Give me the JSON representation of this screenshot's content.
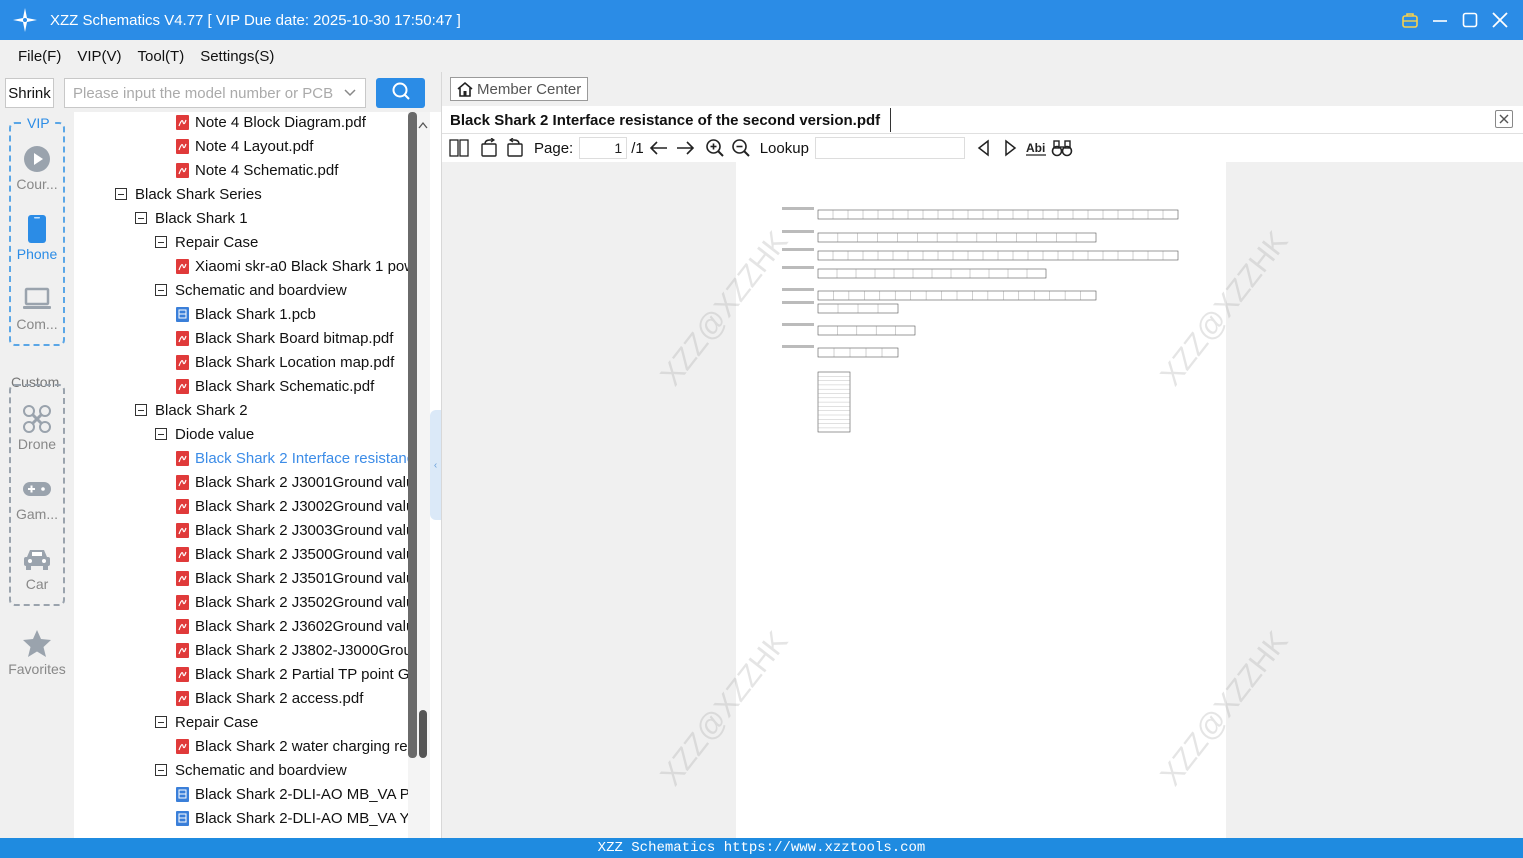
{
  "app": {
    "title": "XZZ Schematics V4.77 [ VIP Due date: 2025-10-30 17:50:47 ]",
    "accent_color": "#2b8ce6"
  },
  "menu": [
    "File(F)",
    "VIP(V)",
    "Tool(T)",
    "Settings(S)"
  ],
  "search": {
    "shrink_label": "Shrink",
    "placeholder": "Please input the model number or PCB"
  },
  "sidebar": {
    "vip_label": "VIP",
    "custom_label": "Custom",
    "items": [
      {
        "label": "Cour...",
        "icon": "play-circle-icon"
      },
      {
        "label": "Phone",
        "icon": "phone-icon"
      },
      {
        "label": "Com...",
        "icon": "laptop-icon"
      },
      {
        "label": "Drone",
        "icon": "drone-icon"
      },
      {
        "label": "Gam...",
        "icon": "gamepad-icon"
      },
      {
        "label": "Car",
        "icon": "car-icon"
      },
      {
        "label": "Favorites",
        "icon": "star-icon"
      }
    ]
  },
  "tree": [
    {
      "label": "Note 4 Block Diagram.pdf",
      "level": 4,
      "type": "pdf"
    },
    {
      "label": "Note 4 Layout.pdf",
      "level": 4,
      "type": "pdf"
    },
    {
      "label": "Note 4 Schematic.pdf",
      "level": 4,
      "type": "pdf"
    },
    {
      "label": "Black Shark Series",
      "level": 1,
      "type": "folder"
    },
    {
      "label": "Black Shark 1",
      "level": 2,
      "type": "folder"
    },
    {
      "label": "Repair Case",
      "level": 3,
      "type": "folder"
    },
    {
      "label": "Xiaomi skr-a0 Black Shark 1 pow",
      "level": 4,
      "type": "pdf"
    },
    {
      "label": "Schematic and boardview",
      "level": 3,
      "type": "folder"
    },
    {
      "label": "Black Shark 1.pcb",
      "level": 4,
      "type": "pcb"
    },
    {
      "label": "Black Shark Board bitmap.pdf",
      "level": 4,
      "type": "pdf"
    },
    {
      "label": "Black Shark Location map.pdf",
      "level": 4,
      "type": "pdf"
    },
    {
      "label": "Black Shark Schematic.pdf",
      "level": 4,
      "type": "pdf"
    },
    {
      "label": "Black Shark 2",
      "level": 2,
      "type": "folder"
    },
    {
      "label": "Diode value",
      "level": 3,
      "type": "folder"
    },
    {
      "label": "Black Shark 2 Interface resistanc",
      "level": 4,
      "type": "pdf",
      "selected": true
    },
    {
      "label": "Black Shark 2 J3001Ground valu",
      "level": 4,
      "type": "pdf"
    },
    {
      "label": "Black Shark 2 J3002Ground valu",
      "level": 4,
      "type": "pdf"
    },
    {
      "label": "Black Shark 2 J3003Ground valu",
      "level": 4,
      "type": "pdf"
    },
    {
      "label": "Black Shark 2 J3500Ground valu",
      "level": 4,
      "type": "pdf"
    },
    {
      "label": "Black Shark 2 J3501Ground valu",
      "level": 4,
      "type": "pdf"
    },
    {
      "label": "Black Shark 2 J3502Ground valu",
      "level": 4,
      "type": "pdf"
    },
    {
      "label": "Black Shark 2 J3602Ground valu",
      "level": 4,
      "type": "pdf"
    },
    {
      "label": "Black Shark 2 J3802-J3000Grour",
      "level": 4,
      "type": "pdf"
    },
    {
      "label": "Black Shark 2 Partial TP point G",
      "level": 4,
      "type": "pdf"
    },
    {
      "label": "Black Shark 2 access.pdf",
      "level": 4,
      "type": "pdf"
    },
    {
      "label": "Repair Case",
      "level": 3,
      "type": "folder"
    },
    {
      "label": "Black Shark 2 water charging re",
      "level": 4,
      "type": "pdf"
    },
    {
      "label": "Schematic and boardview",
      "level": 3,
      "type": "folder"
    },
    {
      "label": "Black Shark 2-DLI-AO MB_VA P",
      "level": 4,
      "type": "pcb"
    },
    {
      "label": "Black Shark 2-DLI-AO MB_VA Y",
      "level": 4,
      "type": "pcb"
    }
  ],
  "viewer": {
    "member_center": "Member Center",
    "tab_title": "Black Shark 2 Interface resistance of the second version.pdf",
    "page_label": "Page:",
    "page_current": "1",
    "page_total": "/1",
    "lookup_label": "Lookup",
    "watermark": "XZZ@XZZHK"
  },
  "status": {
    "text": "XZZ Schematics https://www.xzztools.com"
  }
}
